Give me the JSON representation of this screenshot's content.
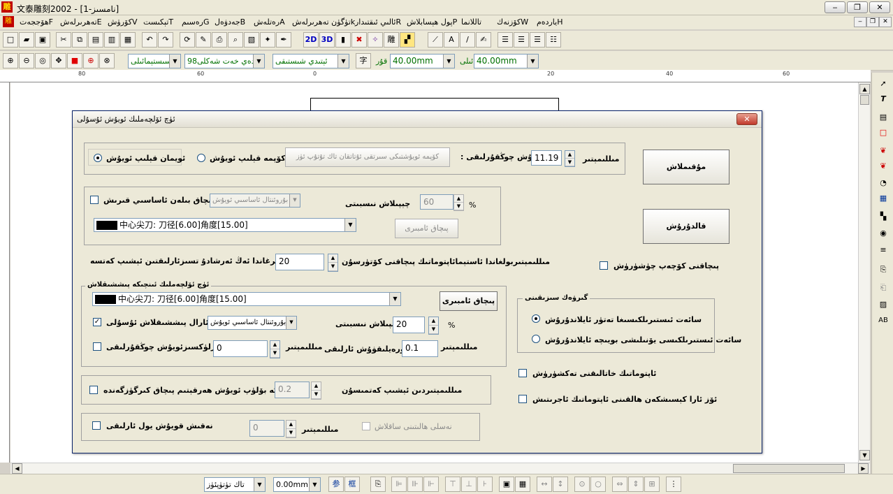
{
  "window": {
    "logo": "雕",
    "title": "文泰雕刻2002 - [نامسىز-1]",
    "min": "‒",
    "max": "❐",
    "close": "✕"
  },
  "menu": {
    "icon": "雕",
    "items": [
      {
        "label": "ياردەمH"
      },
      {
        "label": "كۆزنەكW"
      },
      {
        "label": "تاللانما"
      },
      {
        "label": "پول ھېسابلاشP"
      },
      {
        "label": "ئالىي ئىقتىدارR"
      },
      {
        "label": "تۈگۈن تەھرىرلەشk"
      },
      {
        "label": "رەتلەشA"
      },
      {
        "label": "جەدۋەلB"
      },
      {
        "label": "رەسىمG"
      },
      {
        "label": "تېكىستT"
      },
      {
        "label": "كۆرۈشV"
      },
      {
        "label": "تەھرىرلەشE"
      },
      {
        "label": "ھۆججەتF"
      }
    ]
  },
  "toolbar2": {
    "font_name": "سىستېمائىلى",
    "font_style": "98شادەي خەت شەكلى",
    "font_weight": "ئېتىدي شىستىقى",
    "width_label": "قۇر",
    "width_value": "40.00mm",
    "height_label": "ئىلى",
    "height_value": "40.00mm"
  },
  "ruler": {
    "labels": [
      "80",
      "60",
      "40",
      "20",
      "0",
      "20",
      "40",
      "60",
      "80"
    ]
  },
  "dialog": {
    "title": "ئۈچ ئۆلچەملىك ئويۇش ئۇسۇلى",
    "close": "✕",
    "ok_button": "مۇقىملاش",
    "cancel_button": "قالدۇرۇش",
    "mirror_outline": "ئويمان قېلىپ ئويۇش",
    "mirror_inner": "كۆپمە قېلىپ ئويۇش",
    "mirror_path_button": "كۆپمە ئويۇشتىكى سىرتقى ئۇتاتقان تاك تۇتۇپ ئۈز",
    "depth_label": ": ئويۇش چوڭقۇرلىقى",
    "depth_value": "11.19",
    "depth_unit": "مىللىمېتىر",
    "bevel_label": "بىرلا پىچاق بىلەن ئاساسىي قىرىش",
    "bevel_combo": "بۇروئنتال ئاساسىي ئويۇش",
    "overlap_label": "چېپىلاش نىسبىتى",
    "overlap_value": "60",
    "overlap_unit": "%",
    "tool1": "中心尖刀: 刀径[6.00]角度[15.00]",
    "tool1_button": "پىچاق ئامبىرى",
    "max_depth_label": "مىللىمېتىربولغاندا ئاستېمائاپتوماتىك پىچاقنى كۆتۈرسۇن",
    "max_depth_value": "20",
    "max_depth_tail": "ئاساسىي قىرغاندا ئەڭ ئەرشادۇ تسىزئارلىقتىن ئېشىپ كەتسە",
    "group_fine": "ئۈچ ئۆلچەملىك ئىنچىكە پىششىقلاش",
    "tool2": "中心尖刀: 刀径[6.00]角度[15.00]",
    "tool2_button": "پىچاق ئامبىرى",
    "fine_enable": "بىگانە ئارال پىششىقلاش ئۇسۇلى",
    "fine_combo": "بۇروئنتال ئاساسىي ئويۇش",
    "fine_overlap_label": "چېپىلاش نىسبىتى",
    "fine_overlap_value": "20",
    "fine_overlap_unit": "%",
    "fine_depth_check": "ئۆزلۈكسىزئويۇش چوڭقۇرلىقى",
    "fine_depth_value": "0",
    "fine_depth_unit": "مىللىمېتىر",
    "step_label": "كۆتۈرەيلىقۋۇش ئارلىقى",
    "step_value": "0.1",
    "step_unit": "مىللىمېتىر",
    "layer_check": "قەۋەتكە بۆلۈپ ئويۇش ھەرقېتىم پىچاق كىرگۈزگەندە",
    "layer_value": "0.2",
    "layer_tail": "مىللىمېتىردىن ئېشىپ كەتمىسۇن",
    "path_check": "نەقىش قويۇش يول ئارلىقى",
    "path_value": "0",
    "path_unit": "مىللىمېتىر",
    "path_sub": "نەسلى ھالىتىنى ساقلاش",
    "tool_tip_check": "پىچاقنى كۆچەپ چۈشۈرۈش",
    "group_dir": "گىرۋەك سىزىقىنى",
    "dir_cw": "سائەت ئىستىرىلكىسىغا تەتۈر ئايلاندۇرۇش",
    "dir_ccw": "سائەت ئىستىرىلكىسى يۆنىلىشى بويىچە ئايلاندۇرۇش",
    "auto_check": "ئاپتوماتىك خاتالىقنى تەكشۈرۈش",
    "overlap_check": "ئۆز ئارا كېسىشكەن ھالقىنى ئاپتوماتىك ئاجرىتىش"
  },
  "bottombar": {
    "layer_select": "تاك تۈتۈپئۈز",
    "offset_value": "0.00mm"
  }
}
